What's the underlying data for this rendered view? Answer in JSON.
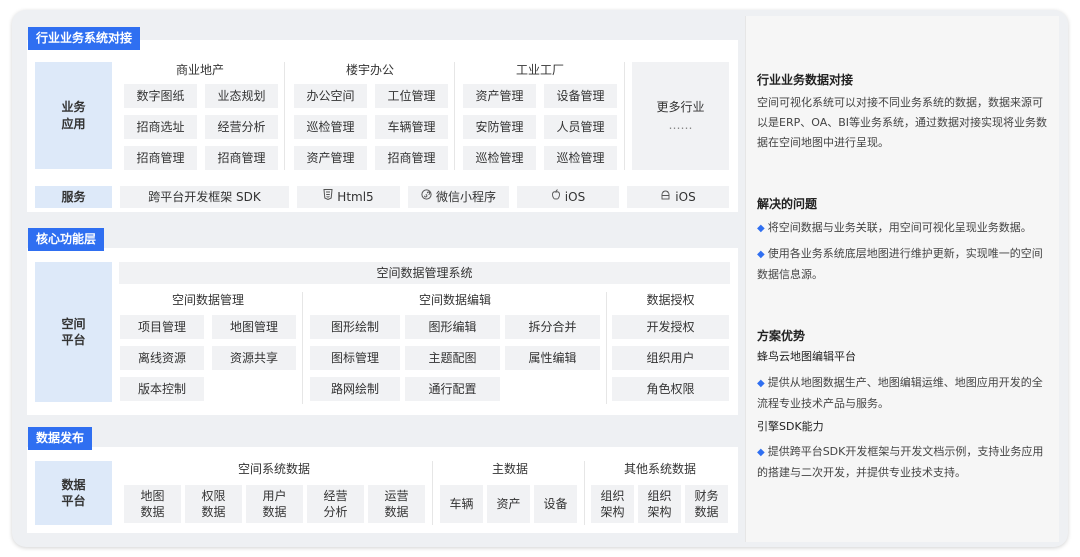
{
  "industry": {
    "title": "行业业务系统对接",
    "biz_label": "业务\n应用",
    "commercial": {
      "header": "商业地产",
      "items": [
        "数字图纸",
        "业态规划",
        "招商选址",
        "经营分析",
        "招商管理",
        "招商管理"
      ]
    },
    "office": {
      "header": "楼宇办公",
      "items": [
        "办公空间",
        "工位管理",
        "巡检管理",
        "车辆管理",
        "资产管理",
        "招商管理"
      ]
    },
    "factory": {
      "header": "工业工厂",
      "items": [
        "资产管理",
        "设备管理",
        "安防管理",
        "人员管理",
        "巡检管理",
        "巡检管理"
      ]
    },
    "more": {
      "label": "更多行业",
      "dots": "……"
    },
    "service_label": "服务",
    "services": [
      {
        "icon": "",
        "label": "跨平台开发框架 SDK"
      },
      {
        "icon": "html5-icon",
        "label": "Html5"
      },
      {
        "icon": "wechat-miniprogram-icon",
        "label": "微信小程序"
      },
      {
        "icon": "apple-icon",
        "label": "iOS"
      },
      {
        "icon": "android-icon",
        "label": "iOS"
      }
    ]
  },
  "core": {
    "title": "核心功能层",
    "platform_label": "空间\n平台",
    "system_title": "空间数据管理系统",
    "mgmt": {
      "header": "空间数据管理",
      "items": [
        "项目管理",
        "地图管理",
        "离线资源",
        "资源共享",
        "版本控制"
      ]
    },
    "edit": {
      "header": "空间数据编辑",
      "items": [
        "图形绘制",
        "图形编辑",
        "拆分合并",
        "图标管理",
        "主题配图",
        "属性编辑",
        "路网绘制",
        "通行配置"
      ]
    },
    "auth": {
      "header": "数据授权",
      "items": [
        "开发授权",
        "组织用户",
        "角色权限"
      ]
    }
  },
  "publish": {
    "title": "数据发布",
    "platform_label": "数据\n平台",
    "spatial": {
      "header": "空间系统数据",
      "items": [
        "地图\n数据",
        "权限\n数据",
        "用户\n数据",
        "经营\n分析",
        "运营\n数据"
      ]
    },
    "master": {
      "header": "主数据",
      "items": [
        "车辆",
        "资产",
        "设备"
      ]
    },
    "other": {
      "header": "其他系统数据",
      "items": [
        "组织\n架构",
        "组织\n架构",
        "财务\n数据"
      ]
    }
  },
  "right": {
    "h1": "行业业务数据对接",
    "p1": "空间可视化系统可以对接不同业务系统的数据，数据来源可以是ERP、OA、BI等业务系统，通过数据对接实现将业务数据在空间地图中进行呈现。",
    "h2": "解决的问题",
    "b1": "将空间数据与业务关联，用空间可视化呈现业务数据。",
    "b2": "使用各业务系统底层地图进行维护更新，实现唯一的空间数据信息源。",
    "h3": "方案优势",
    "sub1": "蜂鸟云地图编辑平台",
    "b3": "提供从地图数据生产、地图编辑运维、地图应用开发的全流程专业技术产品与服务。",
    "sub2": "引擎SDK能力",
    "b4": "提供跨平台SDK开发框架与开发文档示例，支持业务应用的搭建与二次开发，并提供专业技术支持。",
    "bullet": "◆"
  }
}
